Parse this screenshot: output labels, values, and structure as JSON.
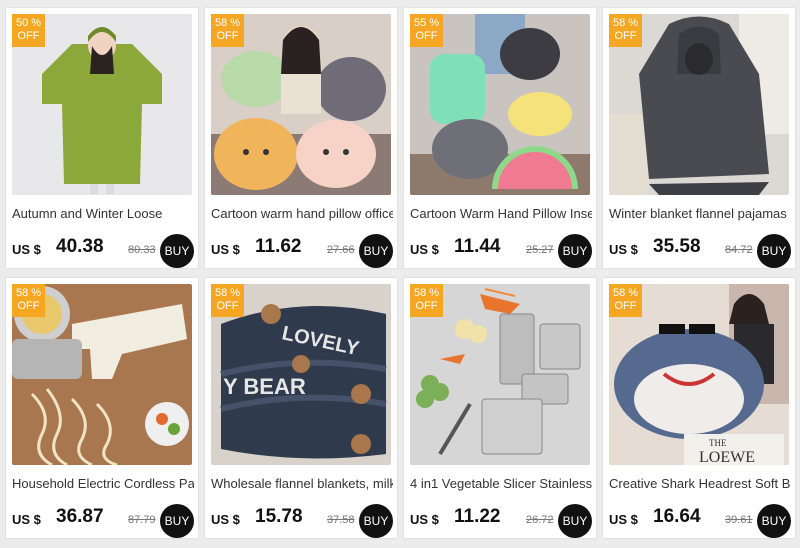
{
  "colors": {
    "badge": "#f5a623",
    "buy_button": "#111111",
    "page_background": "#ececec"
  },
  "products": [
    {
      "discount_pct": "50 %",
      "discount_off": "OFF",
      "title": "Autumn and Winter Loose",
      "currency": "US $",
      "price": "40.38",
      "original_price": "80.33",
      "buy_label": "BUY",
      "image": "green-hooded-blanket-robe-photo"
    },
    {
      "discount_pct": "58 %",
      "discount_off": "OFF",
      "title": "Cartoon warm hand pillow office",
      "currency": "US $",
      "price": "11.62",
      "original_price": "27.66",
      "buy_label": "BUY",
      "image": "plush-animal-pillows-photo"
    },
    {
      "discount_pct": "55 %",
      "discount_off": "OFF",
      "title": "Cartoon Warm Hand Pillow Insert",
      "currency": "US $",
      "price": "11.44",
      "original_price": "25.27",
      "buy_label": "BUY",
      "image": "fruit-plush-pillows-photo"
    },
    {
      "discount_pct": "58 %",
      "discount_off": "OFF",
      "title": "Winter blanket flannel pajamas",
      "currency": "US $",
      "price": "35.58",
      "original_price": "84.72",
      "buy_label": "BUY",
      "image": "grey-flannel-hoodie-blanket-photo"
    },
    {
      "discount_pct": "58 %",
      "discount_off": "OFF",
      "title": "Household Electric Cordless Pasta",
      "currency": "US $",
      "price": "36.87",
      "original_price": "87.79",
      "buy_label": "BUY",
      "image": "electric-pasta-maker-photo"
    },
    {
      "discount_pct": "58 %",
      "discount_off": "OFF",
      "title": "Wholesale flannel blankets, milk",
      "currency": "US $",
      "price": "15.78",
      "original_price": "37.58",
      "buy_label": "BUY",
      "image": "navy-bear-flannel-blanket-photo",
      "image_text_1": "LOVELY",
      "image_text_2": "Y BEAR"
    },
    {
      "discount_pct": "58 %",
      "discount_off": "OFF",
      "title": "4 in1 Vegetable Slicer Stainless",
      "currency": "US $",
      "price": "11.22",
      "original_price": "26.72",
      "buy_label": "BUY",
      "image": "vegetable-slicer-grater-photo"
    },
    {
      "discount_pct": "58 %",
      "discount_off": "OFF",
      "title": "Creative Shark Headrest Soft Bag",
      "currency": "US $",
      "price": "16.64",
      "original_price": "39.61",
      "buy_label": "BUY",
      "image": "shark-headrest-pillow-photo",
      "image_text_1": "LOEWE",
      "image_text_2": "THE"
    }
  ]
}
